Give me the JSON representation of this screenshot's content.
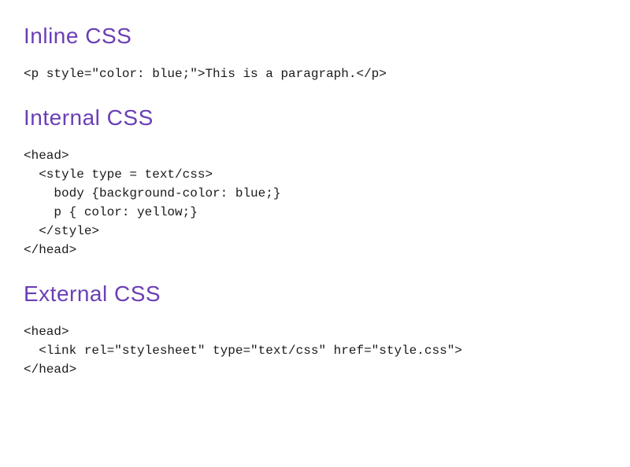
{
  "sections": [
    {
      "heading": "Inline CSS",
      "code": "<p style=\"color: blue;\">This is a paragraph.</p>"
    },
    {
      "heading": "Internal CSS",
      "code": "<head>\n  <style type = text/css>\n    body {background-color: blue;}\n    p { color: yellow;}\n  </style>\n</head>"
    },
    {
      "heading": "External CSS",
      "code": "<head>\n  <link rel=\"stylesheet\" type=\"text/css\" href=\"style.css\">\n</head>"
    }
  ]
}
